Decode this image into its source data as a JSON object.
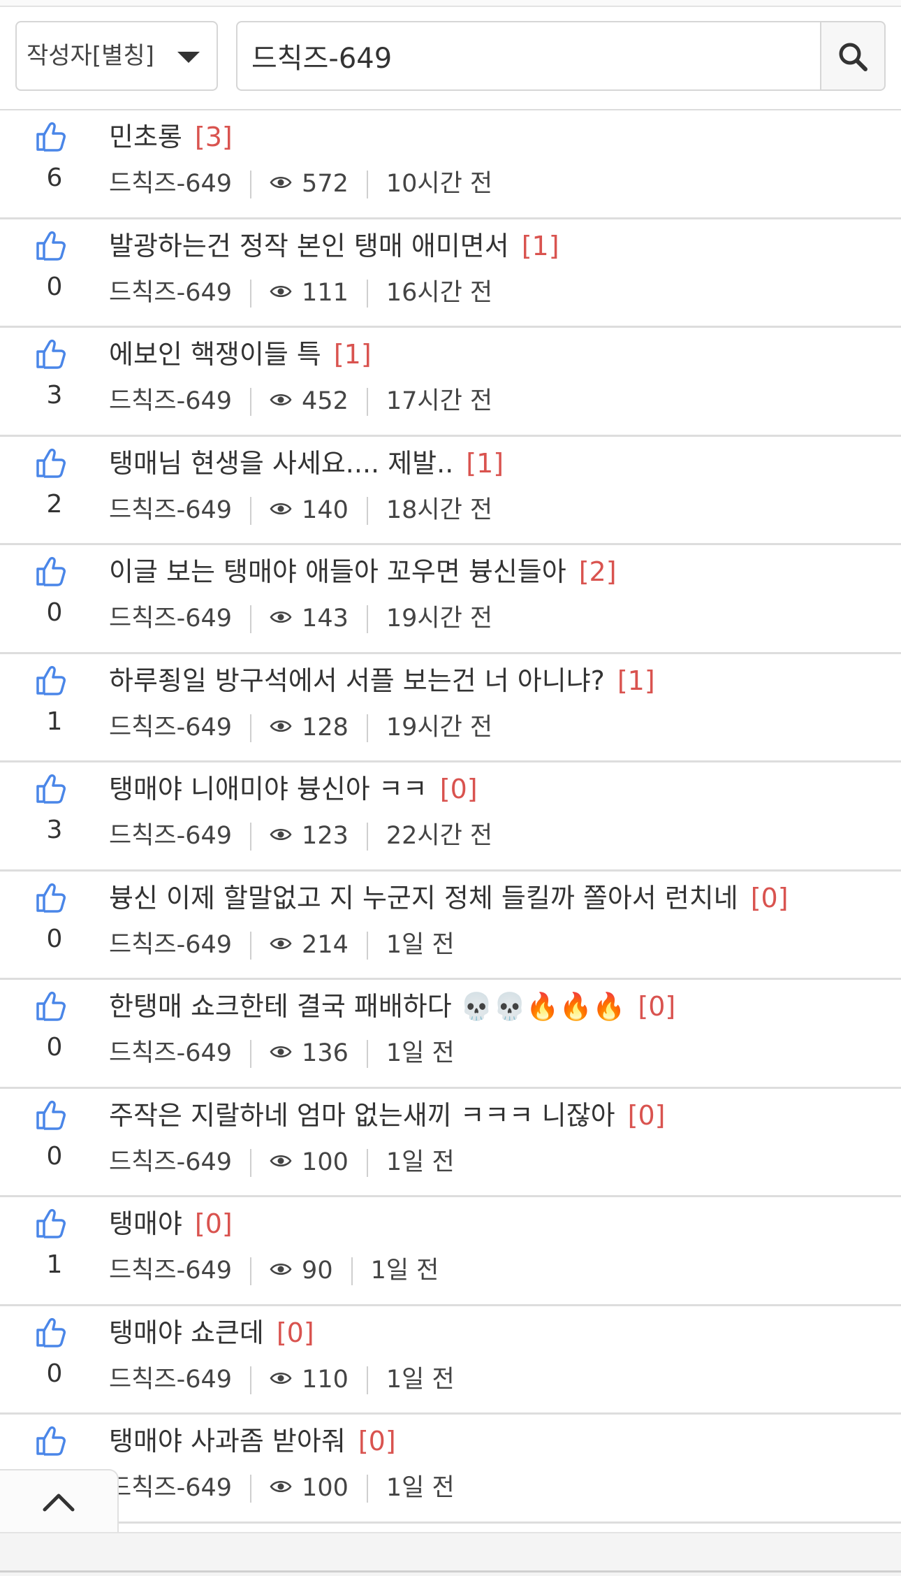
{
  "search": {
    "filter_label": "작성자[별칭]",
    "query": "드칙즈-649"
  },
  "colors": {
    "like_icon": "#4a86e8",
    "comment_count": "#d9534f",
    "divider": "#dddddd"
  },
  "posts": [
    {
      "likes": "6",
      "title": "민초롱",
      "comments": "[3]",
      "author": "드칙즈-649",
      "views": "572",
      "time": "10시간 전"
    },
    {
      "likes": "0",
      "title": "발광하는건 정작 본인 탱매 애미면서",
      "comments": "[1]",
      "author": "드칙즈-649",
      "views": "111",
      "time": "16시간 전"
    },
    {
      "likes": "3",
      "title": "에보인 핵쟁이들 특",
      "comments": "[1]",
      "author": "드칙즈-649",
      "views": "452",
      "time": "17시간 전"
    },
    {
      "likes": "2",
      "title": "탱매님 현생을 사세요.... 제발..",
      "comments": "[1]",
      "author": "드칙즈-649",
      "views": "140",
      "time": "18시간 전"
    },
    {
      "likes": "0",
      "title": "이글 보는 탱매야 애들아 꼬우면 븅신들아",
      "comments": "[2]",
      "author": "드칙즈-649",
      "views": "143",
      "time": "19시간 전"
    },
    {
      "likes": "1",
      "title": "하루죙일 방구석에서 서플 보는건 너 아니냐?",
      "comments": "[1]",
      "author": "드칙즈-649",
      "views": "128",
      "time": "19시간 전"
    },
    {
      "likes": "3",
      "title": "탱매야 니애미야 븅신아 ㅋㅋ",
      "comments": "[0]",
      "author": "드칙즈-649",
      "views": "123",
      "time": "22시간 전"
    },
    {
      "likes": "0",
      "title": "븅신 이제 할말없고 지 누군지 정체 들킬까 쫄아서 런치네",
      "comments": "[0]",
      "author": "드칙즈-649",
      "views": "214",
      "time": "1일 전"
    },
    {
      "likes": "0",
      "title": "한탱매 쇼크한테 결국 패배하다 💀💀🔥🔥🔥",
      "comments": "[0]",
      "author": "드칙즈-649",
      "views": "136",
      "time": "1일 전"
    },
    {
      "likes": "0",
      "title": "주작은 지랄하네 엄마 없는새끼 ㅋㅋㅋ 니잖아",
      "comments": "[0]",
      "author": "드칙즈-649",
      "views": "100",
      "time": "1일 전"
    },
    {
      "likes": "1",
      "title": "탱매야",
      "comments": "[0]",
      "author": "드칙즈-649",
      "views": "90",
      "time": "1일 전"
    },
    {
      "likes": "0",
      "title": "탱매야 쇼큰데",
      "comments": "[0]",
      "author": "드칙즈-649",
      "views": "110",
      "time": "1일 전"
    },
    {
      "likes": "",
      "title": "탱매야 사과좀 받아줘",
      "comments": "[0]",
      "author": "드칙즈-649",
      "views": "100",
      "time": "1일 전"
    }
  ]
}
